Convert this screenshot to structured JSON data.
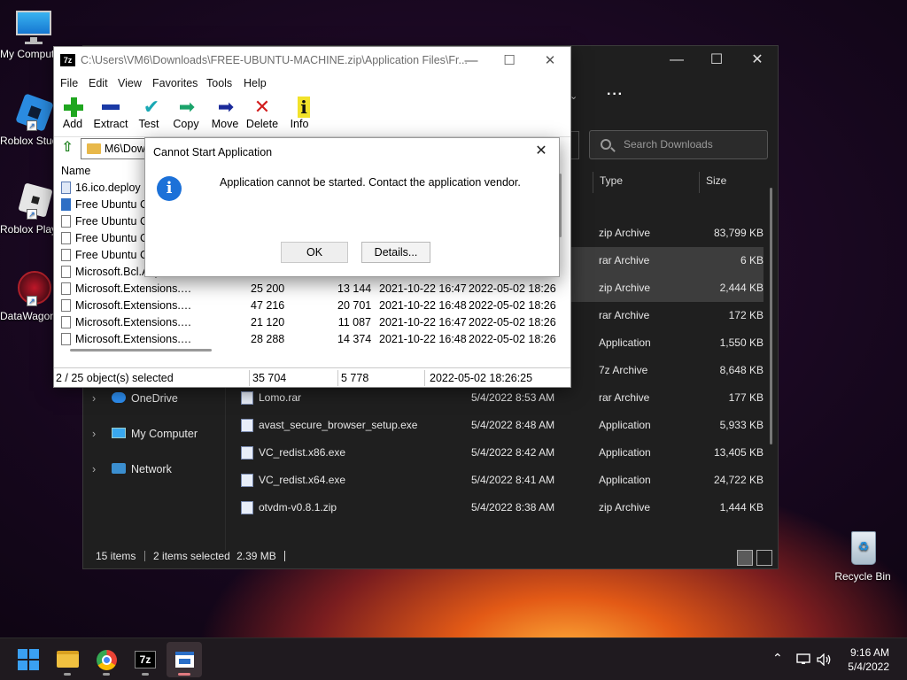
{
  "desktop": {
    "icons": [
      {
        "label": "My Computer"
      },
      {
        "label": "Roblox Studio"
      },
      {
        "label": "Roblox Player"
      },
      {
        "label": "DataWagon"
      },
      {
        "label": "Recycle Bin"
      }
    ]
  },
  "explorer": {
    "search_placeholder": "Search Downloads",
    "columns": {
      "type": "Type",
      "size": "Size"
    },
    "rows": [
      {
        "name": "",
        "date": "",
        "type": "zip Archive",
        "size": "83,799 KB"
      },
      {
        "name": "",
        "date": "",
        "type": "rar Archive",
        "size": "6 KB"
      },
      {
        "name": "",
        "date": "",
        "type": "zip Archive",
        "size": "2,444 KB"
      },
      {
        "name": "",
        "date": "",
        "type": "rar Archive",
        "size": "172 KB"
      },
      {
        "name": "",
        "date": "",
        "type": "Application",
        "size": "1,550 KB"
      },
      {
        "name": "",
        "date": "",
        "type": "7z Archive",
        "size": "8,648 KB"
      },
      {
        "name": "Lomo.rar",
        "date": "5/4/2022 8:53 AM",
        "type": "rar Archive",
        "size": "177 KB"
      },
      {
        "name": "avast_secure_browser_setup.exe",
        "date": "5/4/2022 8:48 AM",
        "type": "Application",
        "size": "5,933 KB"
      },
      {
        "name": "VC_redist.x86.exe",
        "date": "5/4/2022 8:42 AM",
        "type": "Application",
        "size": "13,405 KB"
      },
      {
        "name": "VC_redist.x64.exe",
        "date": "5/4/2022 8:41 AM",
        "type": "Application",
        "size": "24,722 KB"
      },
      {
        "name": "otvdm-v0.8.1.zip",
        "date": "5/4/2022 8:38 AM",
        "type": "zip Archive",
        "size": "1,444 KB"
      }
    ],
    "nav": [
      {
        "label": "OneDrive"
      },
      {
        "label": "My Computer"
      },
      {
        "label": "Network"
      }
    ],
    "status": {
      "items": "15 items",
      "selected": "2 items selected",
      "size": "2.39 MB"
    }
  },
  "sevenzip": {
    "title": "C:\\Users\\VM6\\Downloads\\FREE-UBUNTU-MACHINE.zip\\Application Files\\Fr...",
    "app_icon": "7z",
    "menu": [
      "File",
      "Edit",
      "View",
      "Favorites",
      "Tools",
      "Help"
    ],
    "toolbar": [
      "Add",
      "Extract",
      "Test",
      "Copy",
      "Move",
      "Delete",
      "Info"
    ],
    "address": "M6\\Dow",
    "column_name": "Name",
    "rows": [
      {
        "name": "16.ico.deploy",
        "s1": "",
        "s2": "",
        "d1": "",
        "d2": "",
        "icon": "doc"
      },
      {
        "name": "Free Ubuntu Co",
        "s1": "",
        "s2": "",
        "d1": "",
        "d2": "",
        "icon": "app"
      },
      {
        "name": "Free Ubuntu Co",
        "s1": "",
        "s2": "",
        "d1": "",
        "d2": "",
        "icon": "file"
      },
      {
        "name": "Free Ubuntu Co",
        "s1": "",
        "s2": "",
        "d1": "",
        "d2": "",
        "icon": "file"
      },
      {
        "name": "Free Ubuntu Co",
        "s1": "",
        "s2": "",
        "d1": "",
        "d2": "",
        "icon": "file"
      },
      {
        "name": "Microsoft.Bcl.AsyncInt...",
        "s1": "",
        "s2": "",
        "d1": "",
        "d2": "",
        "icon": "file"
      },
      {
        "name": "Microsoft.Extensions.C...",
        "s1": "25 200",
        "s2": "13 144",
        "d1": "2021-10-22 16:47",
        "d2": "2022-05-02 18:26",
        "icon": "file"
      },
      {
        "name": "Microsoft.Extensions.De...",
        "s1": "47 216",
        "s2": "20 701",
        "d1": "2021-10-22 16:48",
        "d2": "2022-05-02 18:26",
        "icon": "file"
      },
      {
        "name": "Microsoft.Extensions.Fil...",
        "s1": "21 120",
        "s2": "11 087",
        "d1": "2021-10-22 16:47",
        "d2": "2022-05-02 18:26",
        "icon": "file"
      },
      {
        "name": "Microsoft.Extensions.H...",
        "s1": "28 288",
        "s2": "14 374",
        "d1": "2021-10-22 16:48",
        "d2": "2022-05-02 18:26",
        "icon": "file"
      }
    ],
    "status": {
      "selected": "2 / 25 object(s) selected",
      "size": "35 704",
      "packed": "5 778",
      "modified": "2022-05-02 18:26:25"
    }
  },
  "dialog": {
    "title": "Cannot Start Application",
    "message": "Application cannot be started. Contact the application vendor.",
    "ok_label": "OK",
    "details_label": "Details..."
  },
  "taskbar": {
    "time": "9:16 AM",
    "date": "5/4/2022",
    "sevenzip_label": "7z"
  }
}
